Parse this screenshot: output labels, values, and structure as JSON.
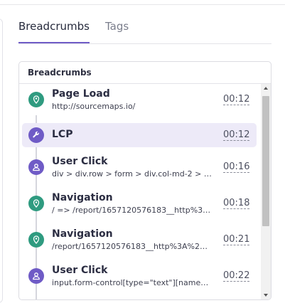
{
  "tabs": [
    {
      "label": "Breadcrumbs",
      "active": true
    },
    {
      "label": "Tags",
      "active": false
    }
  ],
  "panel": {
    "title": "Breadcrumbs"
  },
  "items": [
    {
      "title": "Page Load",
      "subtitle": "http://sourcemaps.io/",
      "time": "00:12",
      "icon": "map-pin-icon",
      "color": "#2f9b80",
      "selected": false
    },
    {
      "title": "LCP",
      "subtitle": "",
      "time": "00:12",
      "icon": "wrench-icon",
      "color": "#6f5bc6",
      "selected": true
    },
    {
      "title": "User Click",
      "subtitle": "div > div.row > form > div.col-md-2 > bu…",
      "time": "00:16",
      "icon": "user-icon",
      "color": "#6f5bc6",
      "selected": false
    },
    {
      "title": "Navigation",
      "subtitle": "/ => /report/1657120576183__http%3…",
      "time": "00:18",
      "icon": "map-pin-icon",
      "color": "#2f9b80",
      "selected": false
    },
    {
      "title": "Navigation",
      "subtitle": "/report/1657120576183__http%3A%2…",
      "time": "00:21",
      "icon": "map-pin-icon",
      "color": "#2f9b80",
      "selected": false
    },
    {
      "title": "User Click",
      "subtitle": "input.form-control[type=\"text\"][name=…",
      "time": "00:22",
      "icon": "user-icon",
      "color": "#6f5bc6",
      "selected": false
    }
  ],
  "colors": {
    "accent": "#6f5bc6",
    "navigation": "#2f9b80"
  }
}
